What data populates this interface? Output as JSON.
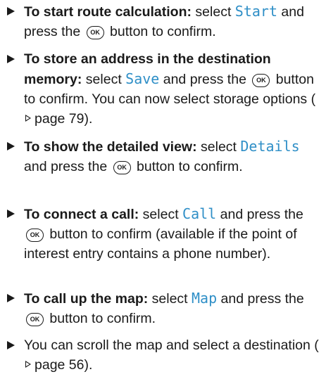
{
  "ok_label": "OK",
  "steps": [
    {
      "bold": "To start route calculation:",
      "pre": " select ",
      "code": "Start",
      "post1": " and press the ",
      "post2": " button to confirm."
    },
    {
      "bold": "To store an address in the destination memory:",
      "pre": " select ",
      "code": "Save",
      "post1": " and press the ",
      "post2": " button to confirm. You can now select storage options (",
      "page_ref": "page 79",
      "post3": ")."
    },
    {
      "bold": "To show the detailed view:",
      "pre": " select ",
      "code": "Details",
      "post1": " and press the ",
      "post2": " button to confirm."
    },
    {
      "bold": "To connect a call:",
      "pre": " select ",
      "code": "Call",
      "post1": " and press the ",
      "post2": " button to confirm (available if the point of interest entry contains a phone number)."
    },
    {
      "bold": "To call up the map:",
      "pre": " select ",
      "code": "Map",
      "post1": " and press the ",
      "post2": " button to confirm."
    },
    {
      "text": "You can scroll the map and select a destination (",
      "page_ref": "page 56",
      "post": ")."
    }
  ],
  "colors": {
    "code": "#2f8fc7",
    "text": "#1a1a1a"
  }
}
